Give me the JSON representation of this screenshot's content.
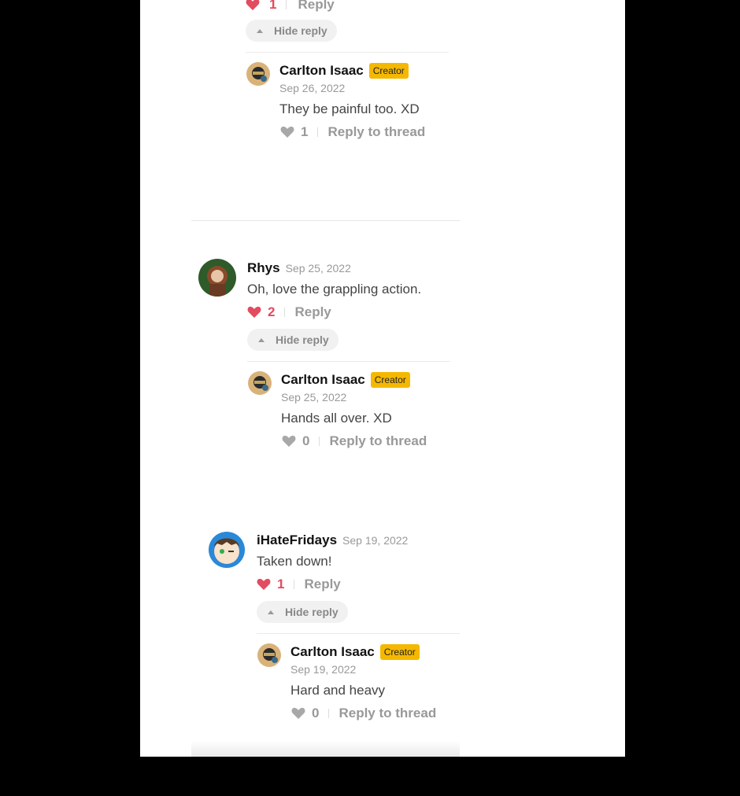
{
  "colors": {
    "like_red": "#e34b5f",
    "muted": "#999999",
    "creator_badge": "#f5b800"
  },
  "threads": [
    {
      "parent": {
        "likes": "1",
        "reply_label": "Reply",
        "hide_label": "Hide reply"
      },
      "reply": {
        "name": "Carlton Isaac",
        "badge": "Creator",
        "date": "Sep 26, 2022",
        "text": "They be painful too. XD",
        "likes": "1",
        "reply_label": "Reply to thread"
      }
    },
    {
      "parent": {
        "name": "Rhys",
        "date": "Sep 25, 2022",
        "text": "Oh, love the grappling action.",
        "likes": "2",
        "reply_label": "Reply",
        "hide_label": "Hide reply"
      },
      "reply": {
        "name": "Carlton Isaac",
        "badge": "Creator",
        "date": "Sep 25, 2022",
        "text": "Hands all over. XD",
        "likes": "0",
        "reply_label": "Reply to thread"
      }
    },
    {
      "parent": {
        "name": "iHateFridays",
        "date": "Sep 19, 2022",
        "text": "Taken down!",
        "likes": "1",
        "reply_label": "Reply",
        "hide_label": "Hide reply"
      },
      "reply": {
        "name": "Carlton Isaac",
        "badge": "Creator",
        "date": "Sep 19, 2022",
        "text": "Hard and heavy",
        "likes": "0",
        "reply_label": "Reply to thread"
      }
    }
  ]
}
